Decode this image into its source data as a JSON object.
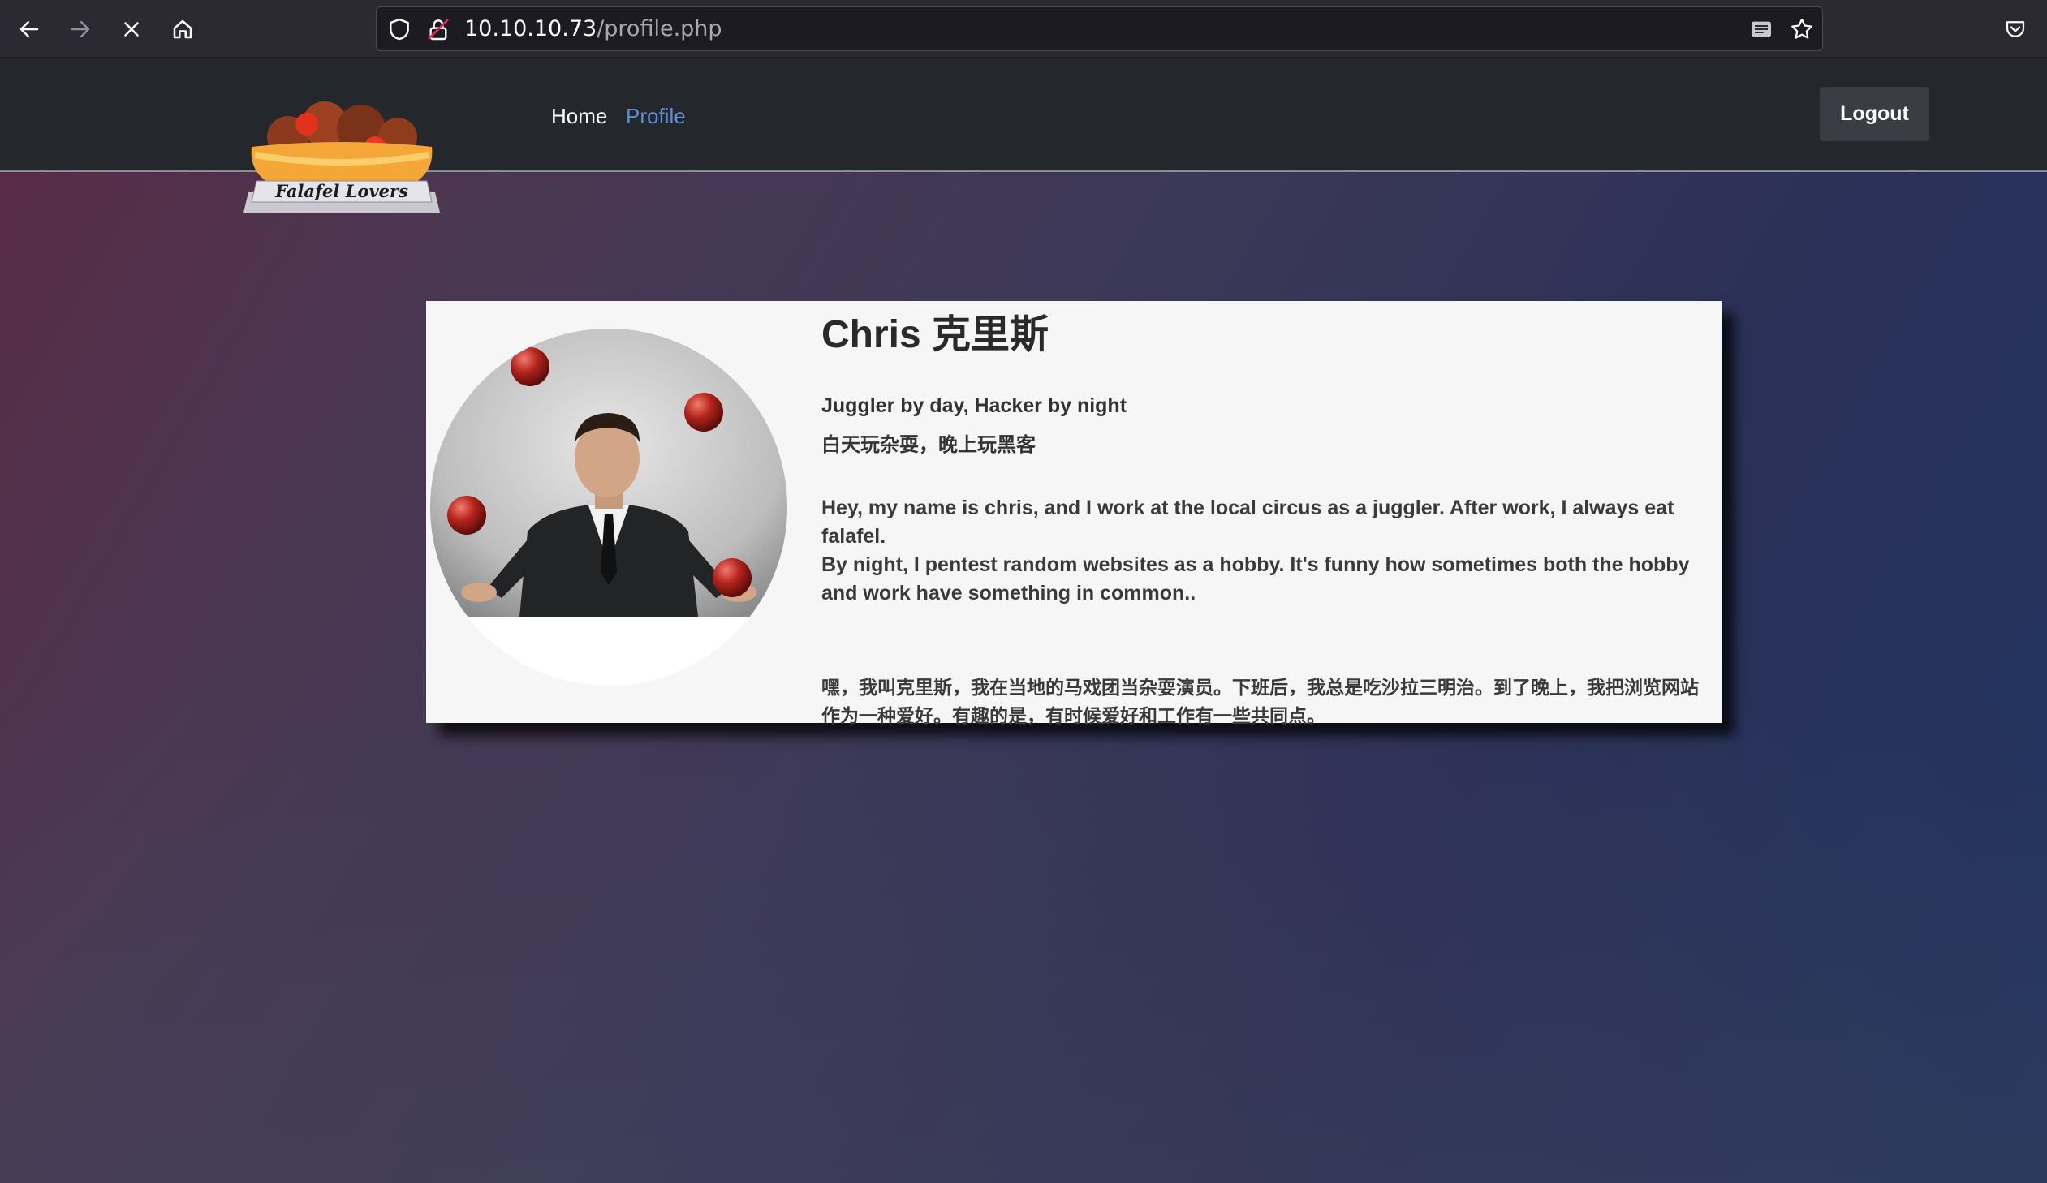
{
  "browser": {
    "url_host": "10.10.10.73",
    "url_path": "/profile.php",
    "icons": [
      "back-arrow-icon",
      "forward-arrow-icon",
      "stop-loading-icon",
      "home-icon",
      "shield-icon",
      "insecure-lock-icon",
      "reader-mode-icon",
      "bookmark-star-icon",
      "pocket-icon"
    ]
  },
  "site": {
    "logo_text": "Falafel Lovers",
    "nav": {
      "home_label": "Home",
      "profile_label": "Profile"
    },
    "logout_label": "Logout"
  },
  "profile": {
    "name": "Chris 克里斯",
    "tagline": "Juggler by day, Hacker by night",
    "tagline_zh": "白天玩杂耍，晚上玩黑客",
    "bio_line1": "Hey, my name is chris, and I work at the local circus as a juggler. After work, I always eat falafel.",
    "bio_line2": "By night, I pentest random websites as a hobby. It's funny how sometimes both the hobby and work have something in common..",
    "bio_zh": "嘿，我叫克里斯，我在当地的马戏团当杂耍演员。下班后，我总是吃沙拉三明治。到了晚上，我把浏览网站作为一种爱好。有趣的是，有时候爱好和工作有一些共同点。"
  },
  "colors": {
    "nav_bg": "#24282c",
    "active_link": "#5f8fd6",
    "card_bg": "#f6f6f6",
    "browser_bg": "#2b2a33"
  }
}
